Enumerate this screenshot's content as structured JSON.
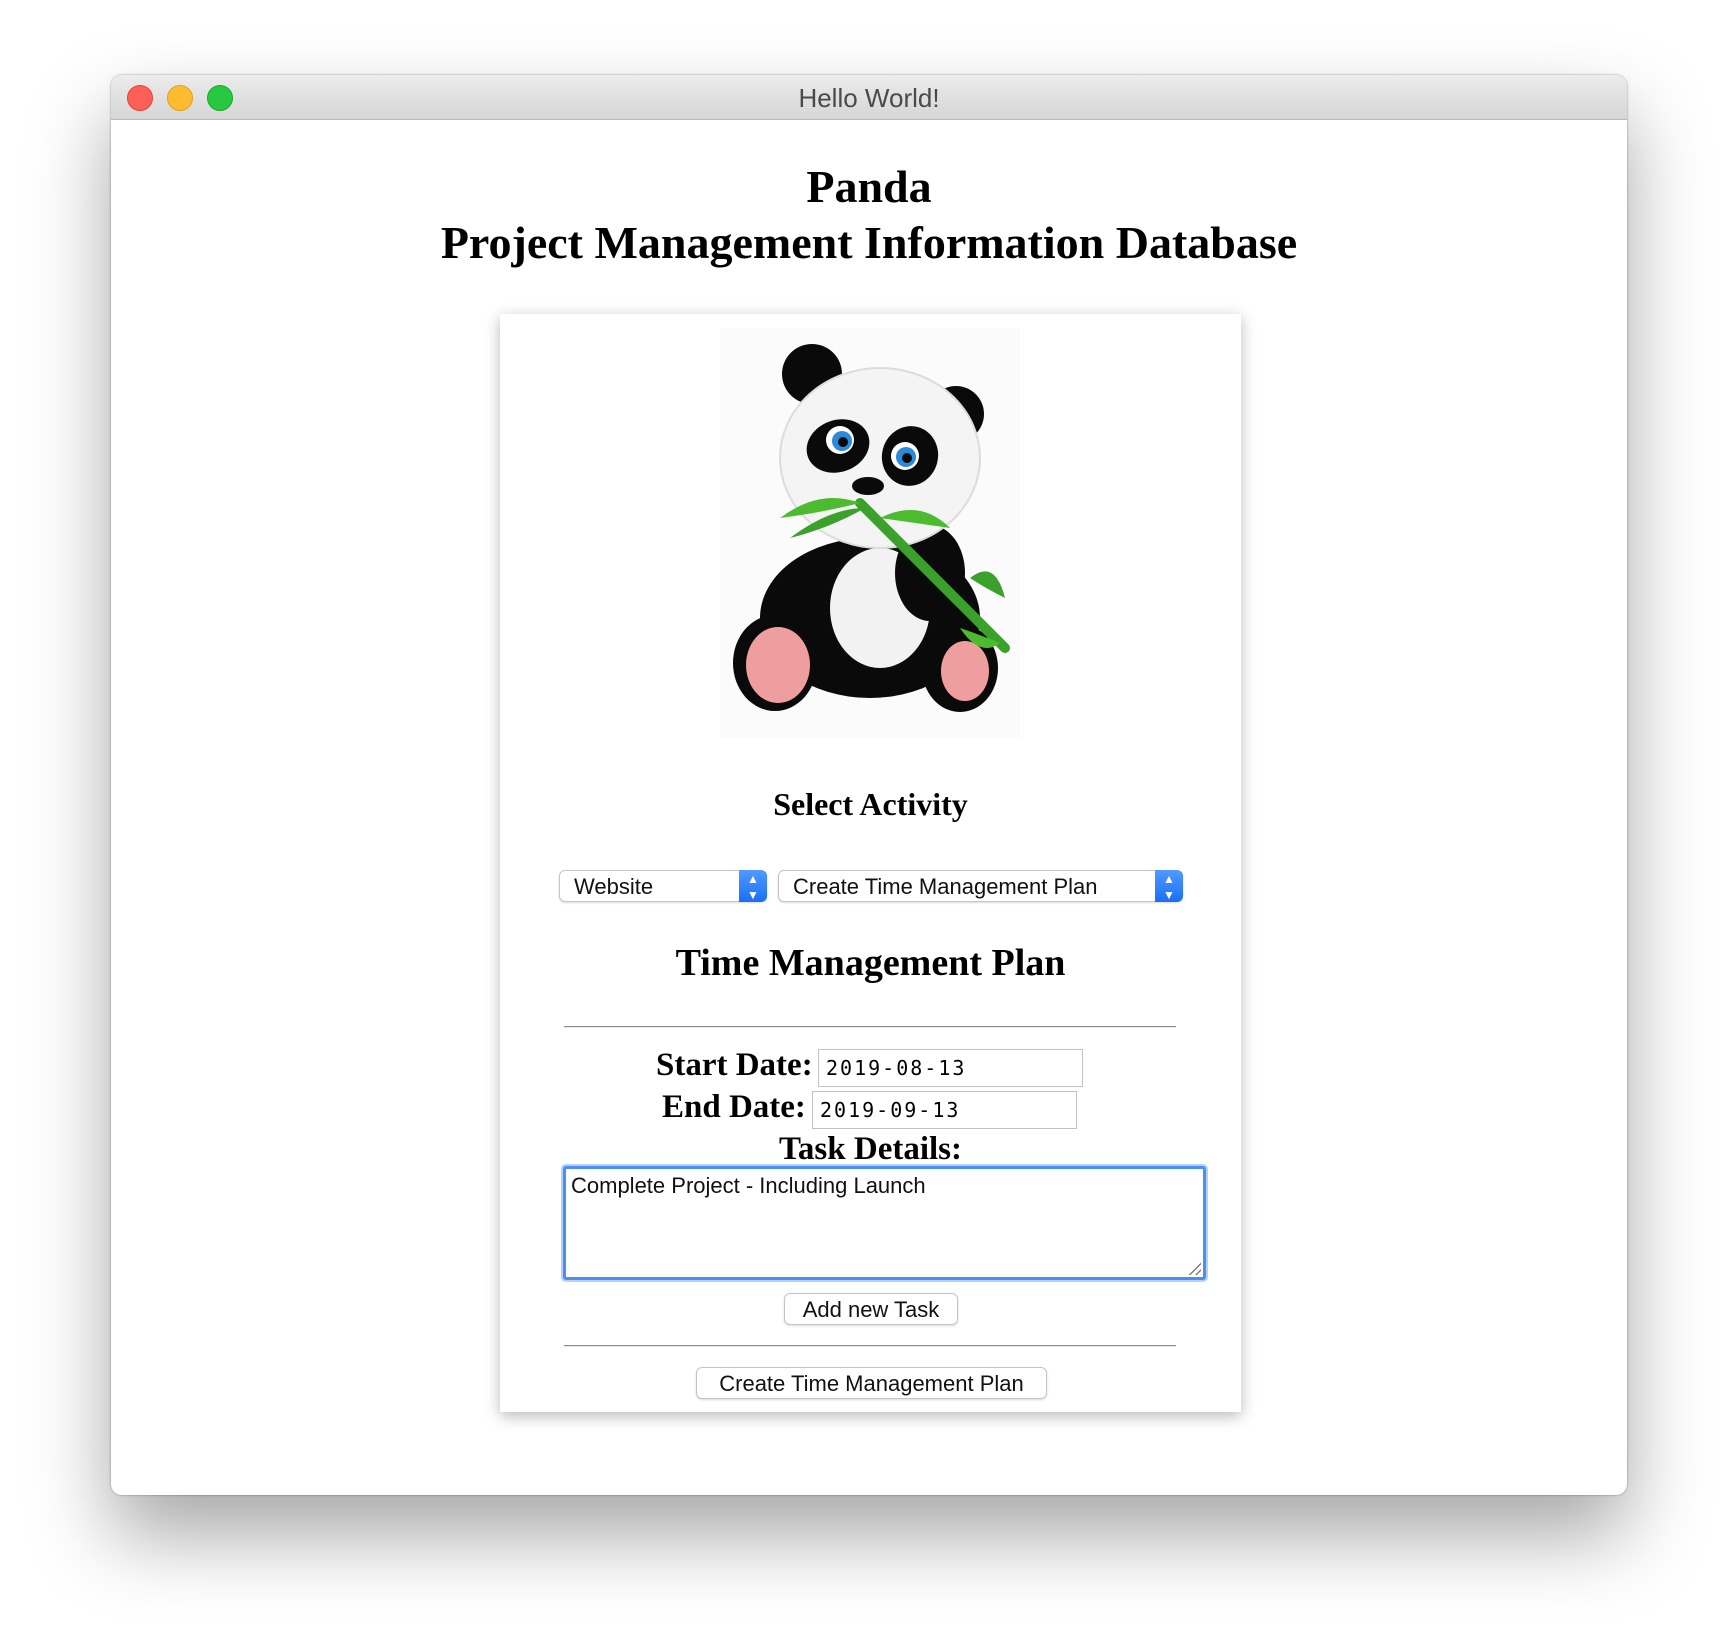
{
  "window": {
    "title": "Hello World!"
  },
  "header": {
    "app_name": "Panda",
    "subtitle": "Project Management Information Database"
  },
  "main": {
    "image": "panda-eating-bamboo",
    "select_heading": "Select Activity",
    "category_select": {
      "value": "Website"
    },
    "activity_select": {
      "value": "Create Time Management Plan"
    },
    "section_heading": "Time Management Plan",
    "start_date": {
      "label": "Start Date:",
      "value": "2019-08-13"
    },
    "end_date": {
      "label": "End Date:",
      "value": "2019-09-13"
    },
    "task_details": {
      "label": "Task Details:",
      "value": "Complete Project - Including Launch"
    },
    "add_task_button": "Add new Task",
    "create_button": "Create Time Management Plan"
  },
  "colors": {
    "accent": "#1b6ef5",
    "focus_ring": "#4a90f0",
    "close": "#fe5f57",
    "minimize": "#febc2e",
    "maximize": "#28c840"
  }
}
